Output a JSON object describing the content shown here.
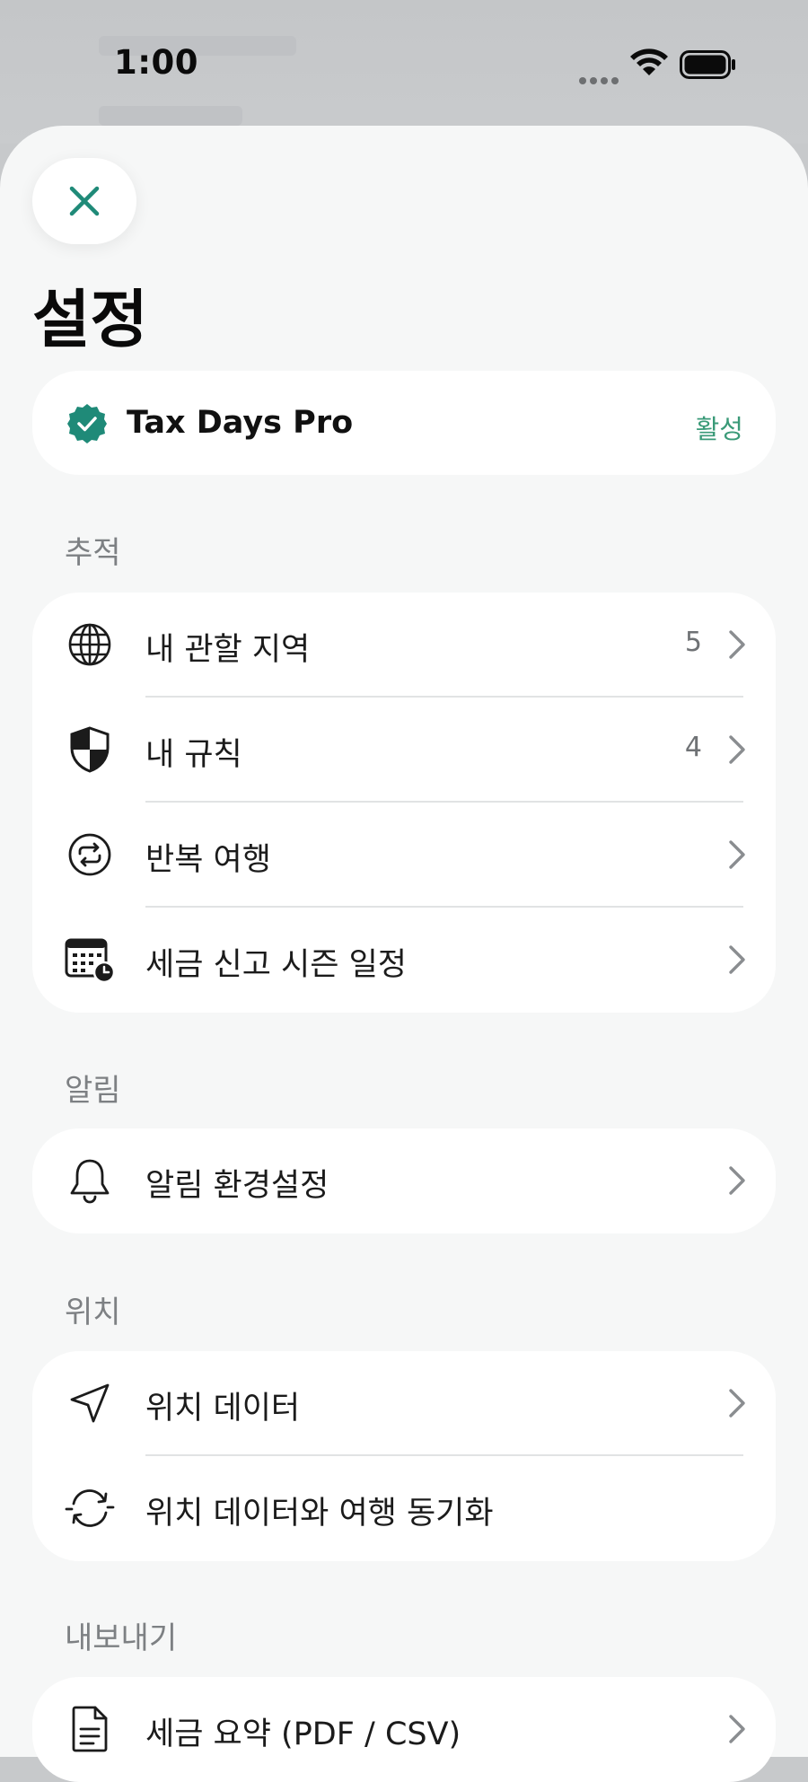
{
  "status_bar": {
    "time": "1:00"
  },
  "header": {
    "title": "설정"
  },
  "pro": {
    "name": "Tax Days Pro",
    "status": "활성"
  },
  "sections": {
    "tracking": {
      "title": "추적",
      "items": [
        {
          "label": "내 관할 지역",
          "value": "5",
          "icon": "globe-icon"
        },
        {
          "label": "내 규칙",
          "value": "4",
          "icon": "shield-icon"
        },
        {
          "label": "반복 여행",
          "value": "",
          "icon": "repeat-icon"
        },
        {
          "label": "세금 신고 시즌 일정",
          "value": "",
          "icon": "calendar-clock-icon"
        }
      ]
    },
    "notifications": {
      "title": "알림",
      "items": [
        {
          "label": "알림 환경설정",
          "icon": "bell-icon"
        }
      ]
    },
    "location": {
      "title": "위치",
      "items": [
        {
          "label": "위치 데이터",
          "icon": "location-arrow-icon"
        },
        {
          "label": "위치 데이터와 여행 동기화",
          "icon": "sync-icon"
        }
      ]
    },
    "export": {
      "title": "내보내기",
      "items": [
        {
          "label": "세금 요약 (PDF / CSV)",
          "icon": "document-icon"
        }
      ]
    }
  },
  "colors": {
    "accent": "#1f8a78",
    "badge": "#1f8a78",
    "active_text": "#3a9a78",
    "sheet_bg": "#f6f7f7"
  }
}
